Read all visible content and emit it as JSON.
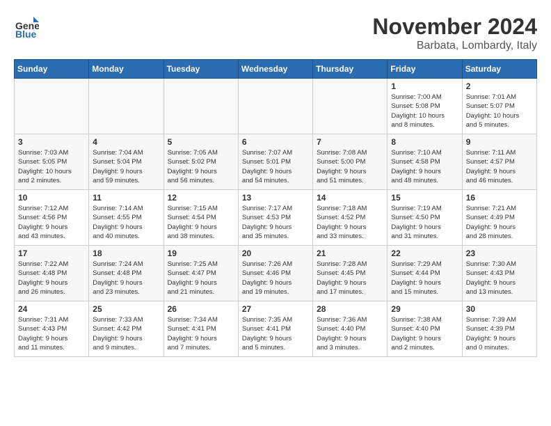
{
  "header": {
    "logo_general": "General",
    "logo_blue": "Blue",
    "month_title": "November 2024",
    "location": "Barbata, Lombardy, Italy"
  },
  "weekdays": [
    "Sunday",
    "Monday",
    "Tuesday",
    "Wednesday",
    "Thursday",
    "Friday",
    "Saturday"
  ],
  "weeks": [
    [
      {
        "day": "",
        "info": ""
      },
      {
        "day": "",
        "info": ""
      },
      {
        "day": "",
        "info": ""
      },
      {
        "day": "",
        "info": ""
      },
      {
        "day": "",
        "info": ""
      },
      {
        "day": "1",
        "info": "Sunrise: 7:00 AM\nSunset: 5:08 PM\nDaylight: 10 hours\nand 8 minutes."
      },
      {
        "day": "2",
        "info": "Sunrise: 7:01 AM\nSunset: 5:07 PM\nDaylight: 10 hours\nand 5 minutes."
      }
    ],
    [
      {
        "day": "3",
        "info": "Sunrise: 7:03 AM\nSunset: 5:05 PM\nDaylight: 10 hours\nand 2 minutes."
      },
      {
        "day": "4",
        "info": "Sunrise: 7:04 AM\nSunset: 5:04 PM\nDaylight: 9 hours\nand 59 minutes."
      },
      {
        "day": "5",
        "info": "Sunrise: 7:05 AM\nSunset: 5:02 PM\nDaylight: 9 hours\nand 56 minutes."
      },
      {
        "day": "6",
        "info": "Sunrise: 7:07 AM\nSunset: 5:01 PM\nDaylight: 9 hours\nand 54 minutes."
      },
      {
        "day": "7",
        "info": "Sunrise: 7:08 AM\nSunset: 5:00 PM\nDaylight: 9 hours\nand 51 minutes."
      },
      {
        "day": "8",
        "info": "Sunrise: 7:10 AM\nSunset: 4:58 PM\nDaylight: 9 hours\nand 48 minutes."
      },
      {
        "day": "9",
        "info": "Sunrise: 7:11 AM\nSunset: 4:57 PM\nDaylight: 9 hours\nand 46 minutes."
      }
    ],
    [
      {
        "day": "10",
        "info": "Sunrise: 7:12 AM\nSunset: 4:56 PM\nDaylight: 9 hours\nand 43 minutes."
      },
      {
        "day": "11",
        "info": "Sunrise: 7:14 AM\nSunset: 4:55 PM\nDaylight: 9 hours\nand 40 minutes."
      },
      {
        "day": "12",
        "info": "Sunrise: 7:15 AM\nSunset: 4:54 PM\nDaylight: 9 hours\nand 38 minutes."
      },
      {
        "day": "13",
        "info": "Sunrise: 7:17 AM\nSunset: 4:53 PM\nDaylight: 9 hours\nand 35 minutes."
      },
      {
        "day": "14",
        "info": "Sunrise: 7:18 AM\nSunset: 4:52 PM\nDaylight: 9 hours\nand 33 minutes."
      },
      {
        "day": "15",
        "info": "Sunrise: 7:19 AM\nSunset: 4:50 PM\nDaylight: 9 hours\nand 31 minutes."
      },
      {
        "day": "16",
        "info": "Sunrise: 7:21 AM\nSunset: 4:49 PM\nDaylight: 9 hours\nand 28 minutes."
      }
    ],
    [
      {
        "day": "17",
        "info": "Sunrise: 7:22 AM\nSunset: 4:48 PM\nDaylight: 9 hours\nand 26 minutes."
      },
      {
        "day": "18",
        "info": "Sunrise: 7:24 AM\nSunset: 4:48 PM\nDaylight: 9 hours\nand 23 minutes."
      },
      {
        "day": "19",
        "info": "Sunrise: 7:25 AM\nSunset: 4:47 PM\nDaylight: 9 hours\nand 21 minutes."
      },
      {
        "day": "20",
        "info": "Sunrise: 7:26 AM\nSunset: 4:46 PM\nDaylight: 9 hours\nand 19 minutes."
      },
      {
        "day": "21",
        "info": "Sunrise: 7:28 AM\nSunset: 4:45 PM\nDaylight: 9 hours\nand 17 minutes."
      },
      {
        "day": "22",
        "info": "Sunrise: 7:29 AM\nSunset: 4:44 PM\nDaylight: 9 hours\nand 15 minutes."
      },
      {
        "day": "23",
        "info": "Sunrise: 7:30 AM\nSunset: 4:43 PM\nDaylight: 9 hours\nand 13 minutes."
      }
    ],
    [
      {
        "day": "24",
        "info": "Sunrise: 7:31 AM\nSunset: 4:43 PM\nDaylight: 9 hours\nand 11 minutes."
      },
      {
        "day": "25",
        "info": "Sunrise: 7:33 AM\nSunset: 4:42 PM\nDaylight: 9 hours\nand 9 minutes."
      },
      {
        "day": "26",
        "info": "Sunrise: 7:34 AM\nSunset: 4:41 PM\nDaylight: 9 hours\nand 7 minutes."
      },
      {
        "day": "27",
        "info": "Sunrise: 7:35 AM\nSunset: 4:41 PM\nDaylight: 9 hours\nand 5 minutes."
      },
      {
        "day": "28",
        "info": "Sunrise: 7:36 AM\nSunset: 4:40 PM\nDaylight: 9 hours\nand 3 minutes."
      },
      {
        "day": "29",
        "info": "Sunrise: 7:38 AM\nSunset: 4:40 PM\nDaylight: 9 hours\nand 2 minutes."
      },
      {
        "day": "30",
        "info": "Sunrise: 7:39 AM\nSunset: 4:39 PM\nDaylight: 9 hours\nand 0 minutes."
      }
    ]
  ]
}
